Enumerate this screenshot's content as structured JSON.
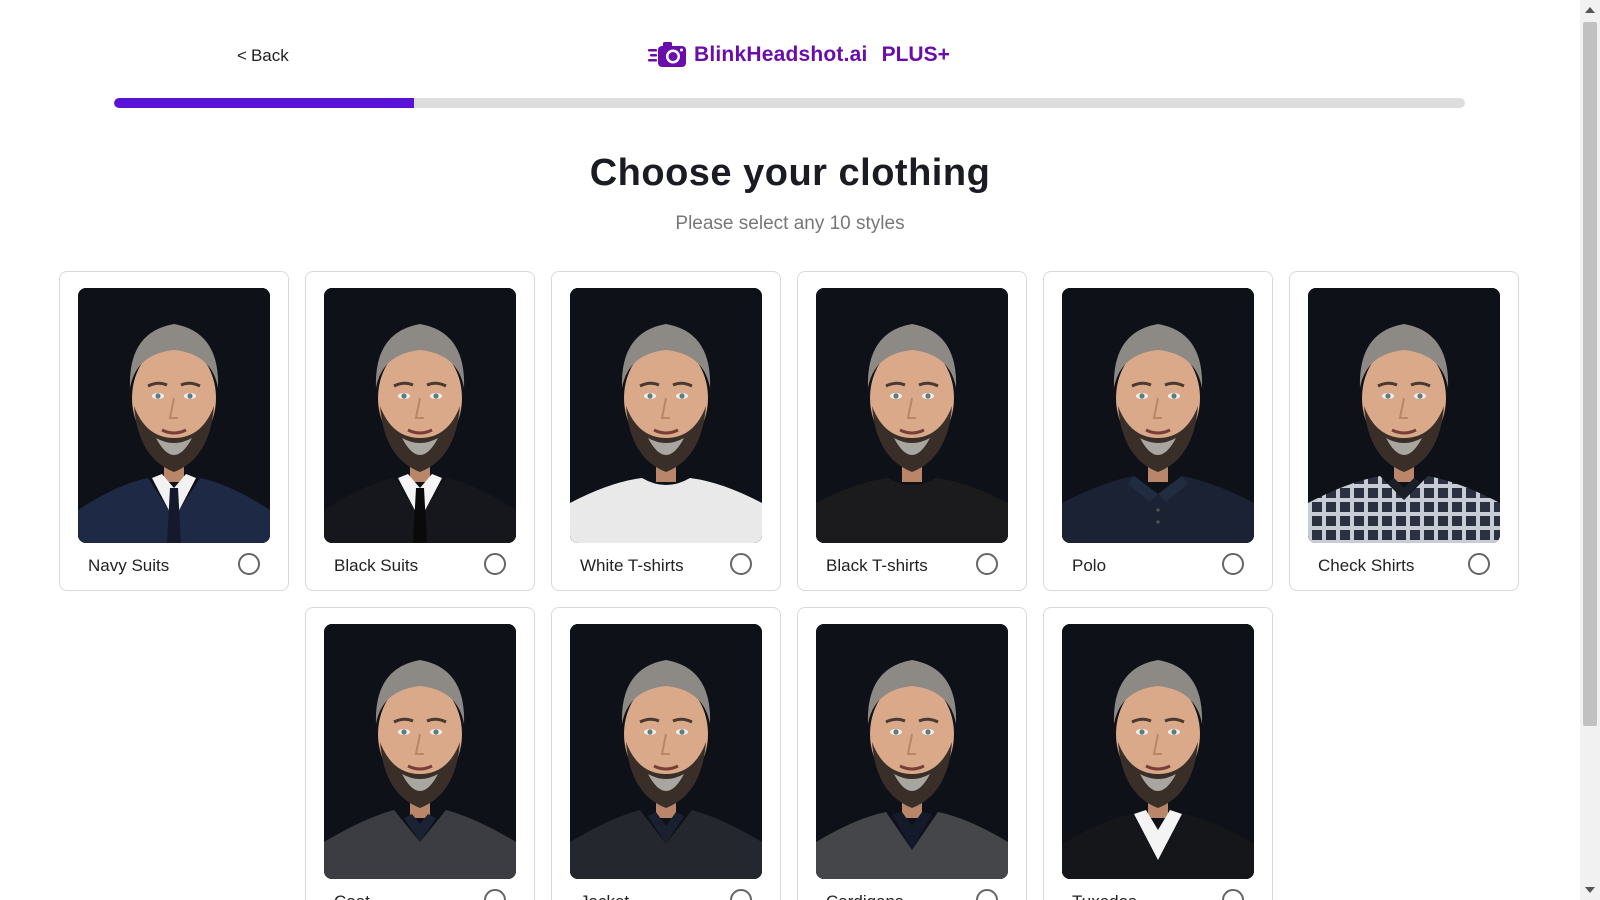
{
  "header": {
    "back_label": "Back",
    "back_chevron": "<",
    "logo_text": "BlinkHeadshot.ai",
    "logo_plus": "PLUS+",
    "logo_icon": "camera-speed-icon",
    "brand_color": "#6a0dad"
  },
  "progress": {
    "fraction": 0.222,
    "fill_color": "#5a12d6",
    "track_color": "#dddddd"
  },
  "main": {
    "title": "Choose your clothing",
    "subtitle": "Please select any 10 styles"
  },
  "styles": [
    {
      "label": "Navy Suits",
      "selected": false,
      "outfit": "navy-suit"
    },
    {
      "label": "Black Suits",
      "selected": false,
      "outfit": "black-suit"
    },
    {
      "label": "White T-shirts",
      "selected": false,
      "outfit": "white-tee"
    },
    {
      "label": "Black T-shirts",
      "selected": false,
      "outfit": "black-tee"
    },
    {
      "label": "Polo",
      "selected": false,
      "outfit": "polo"
    },
    {
      "label": "Check Shirts",
      "selected": false,
      "outfit": "check-shirt"
    },
    {
      "label": "Coat",
      "selected": false,
      "outfit": "coat"
    },
    {
      "label": "Jacket",
      "selected": false,
      "outfit": "jacket"
    },
    {
      "label": "Cardigans",
      "selected": false,
      "outfit": "cardigan"
    },
    {
      "label": "Tuxedos",
      "selected": false,
      "outfit": "tuxedo"
    }
  ]
}
